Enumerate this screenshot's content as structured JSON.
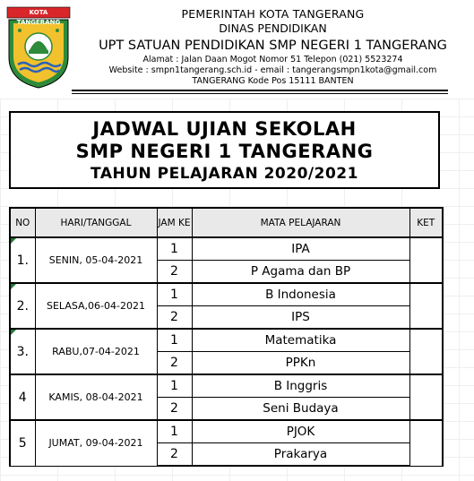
{
  "letterhead": {
    "logo_label": "KOTA TANGERANG",
    "line1": "PEMERINTAH KOTA TANGERANG",
    "line2": "DINAS PENDIDIKAN",
    "line3": "UPT SATUAN PENDIDIKAN SMP NEGERI 1 TANGERANG",
    "line4": "Alamat : Jalan Daan Mogot Nomor  51 Telepon (021) 5523274",
    "line5": "Website : smpn1tangerang.sch.id - email : tangerangsmpn1kota@gmail.com",
    "line6": "TANGERANG Kode Pos 15111 BANTEN"
  },
  "title": {
    "line1": "JADWAL UJIAN SEKOLAH",
    "line2": "SMP NEGERI 1 TANGERANG",
    "line3": "TAHUN PELAJARAN 2020/2021"
  },
  "table": {
    "headers": {
      "no": "NO",
      "day": "HARI/TANGGAL",
      "jam": "JAM KE",
      "subject": "MATA PELAJARAN",
      "ket": "KET"
    },
    "groups": [
      {
        "no": "1.",
        "day": "SENIN, 05-04-2021",
        "rows": [
          {
            "jam": "1",
            "subject": "IPA"
          },
          {
            "jam": "2",
            "subject": "P Agama dan BP"
          }
        ]
      },
      {
        "no": "2.",
        "day": "SELASA,06-04-2021",
        "rows": [
          {
            "jam": "1",
            "subject": "B Indonesia"
          },
          {
            "jam": "2",
            "subject": "IPS"
          }
        ]
      },
      {
        "no": "3.",
        "day": "RABU,07-04-2021",
        "rows": [
          {
            "jam": "1",
            "subject": "Matematika"
          },
          {
            "jam": "2",
            "subject": "PPKn"
          }
        ]
      },
      {
        "no": "4",
        "day": "KAMIS, 08-04-2021",
        "rows": [
          {
            "jam": "1",
            "subject": "B Inggris"
          },
          {
            "jam": "2",
            "subject": "Seni Budaya"
          }
        ]
      },
      {
        "no": "5",
        "day": "JUMAT, 09-04-2021",
        "rows": [
          {
            "jam": "1",
            "subject": "PJOK"
          },
          {
            "jam": "2",
            "subject": "Prakarya"
          }
        ]
      }
    ]
  },
  "colors": {
    "border": "#000000",
    "header_bg": "#e9e9e9",
    "cell_marker": "#1e7a33",
    "logo_green": "#2e8b3a",
    "logo_yellow": "#f2c12e",
    "logo_blue": "#2a63b8"
  }
}
